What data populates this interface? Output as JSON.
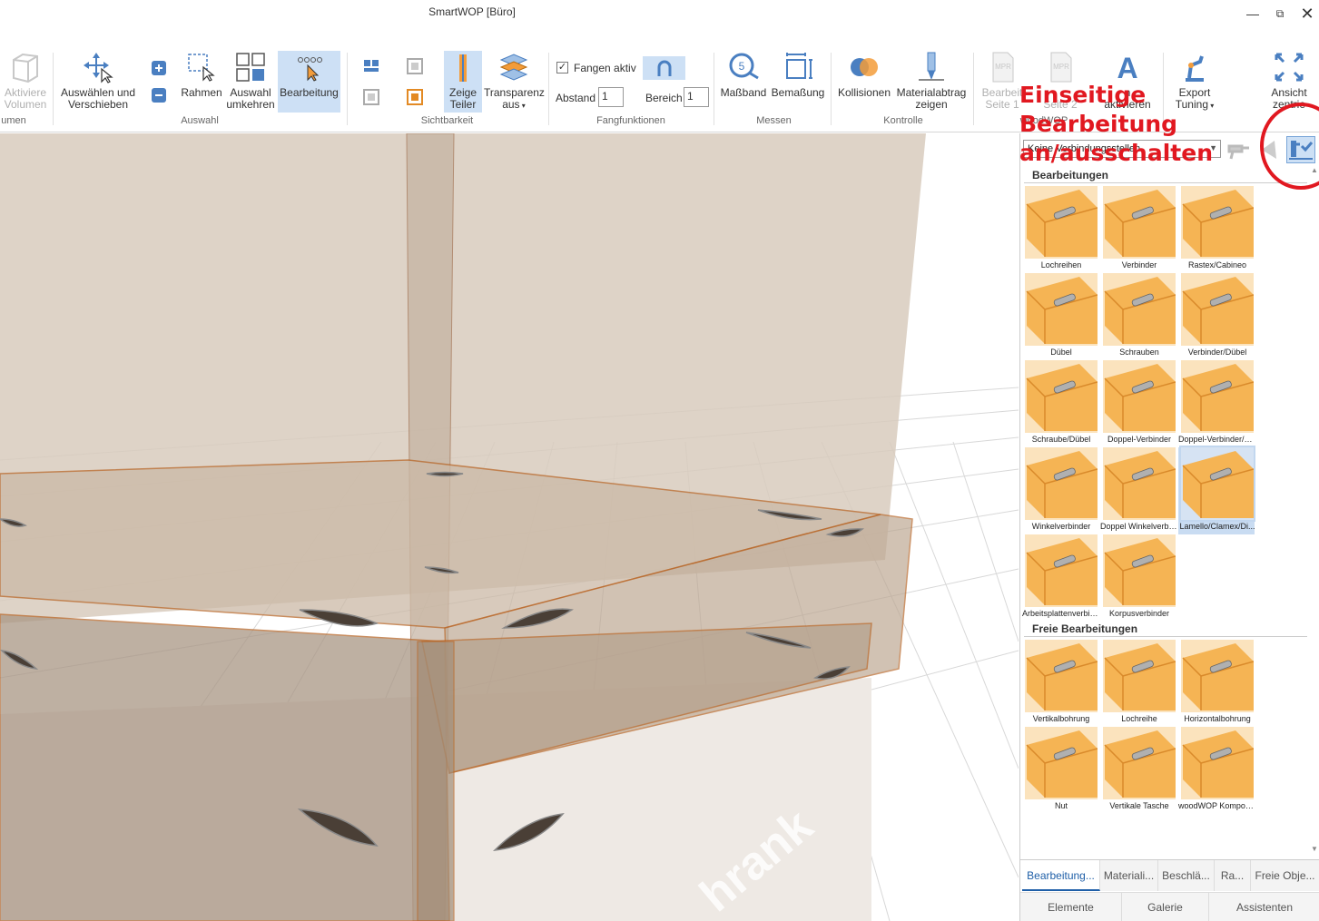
{
  "window": {
    "title": "SmartWOP [Büro]",
    "minimize_icon": "minimize-icon",
    "restore_icon": "restore-icon",
    "close_icon": "close-icon"
  },
  "ribbon": {
    "volumen": {
      "line1": "Aktiviere",
      "line2": "Volumen",
      "group_label": "umen"
    },
    "auswahl": {
      "select_move": {
        "line1": "Auswählen und",
        "line2": "Verschieben"
      },
      "rahmen": "Rahmen",
      "auswahl_umkehren": {
        "line1": "Auswahl",
        "line2": "umkehren"
      },
      "bearbeitung": "Bearbeitung",
      "group_label": "Auswahl"
    },
    "sichtbarkeit": {
      "zeige_teiler": {
        "line1": "Zeige",
        "line2": "Teiler"
      },
      "transparenz": {
        "line1": "Transparenz",
        "line2": "aus"
      },
      "group_label": "Sichtbarkeit"
    },
    "fangfunktionen": {
      "fangen_aktiv": "Fangen aktiv",
      "fangen_checked": true,
      "abstand_label": "Abstand",
      "abstand_value": "1",
      "bereich_label": "Bereich",
      "bereich_value": "1",
      "group_label": "Fangfunktionen"
    },
    "messen": {
      "massband": "Maßband",
      "bemassung": "Bemaßung",
      "group_label": "Messen"
    },
    "kontrolle": {
      "kollisionen": "Kollisionen",
      "materialabtrag": {
        "line1": "Materialabtrag",
        "line2": "zeigen"
      },
      "group_label": "Kontrolle"
    },
    "woodwop": {
      "seite1": {
        "line1": "Bearbeit",
        "line2": "Seite 1"
      },
      "seite2": {
        "line1": "",
        "line2": "Seite 2"
      },
      "aktivieren": {
        "line1": "n",
        "line2": "aktivieren"
      },
      "group_label": "woodWOP"
    },
    "export": {
      "line1": "Export",
      "line2": "Tuning"
    },
    "ansicht": {
      "line1": "Ansicht",
      "line2": "zentrie"
    }
  },
  "panel": {
    "connection_select": "Keine Verbindungsstellen",
    "bearbeitungen_title": "Bearbeitungen",
    "bearbeitungen": [
      "Lochreihen",
      "Verbinder",
      "Rastex/Cabineo",
      "Dübel",
      "Schrauben",
      "Verbinder/Dübel",
      "Schraube/Dübel",
      "Doppel-Verbinder",
      "Doppel-Verbinder/D...",
      "Winkelverbinder",
      "Doppel Winkelverbin...",
      "Lamello/Clamex/Di...",
      "Arbeitsplattenverbin...",
      "Korpusverbinder"
    ],
    "freie_title": "Freie Bearbeitungen",
    "freie": [
      "Vertikalbohrung",
      "Lochreihe",
      "Horizontalbohrung",
      "Nut",
      "Vertikale Tasche",
      "woodWOP Kompon..."
    ],
    "tabs": [
      "Bearbeitung...",
      "Materiali...",
      "Beschlä...",
      "Ra...",
      "Freie Obje..."
    ],
    "bottom_tabs": [
      "Elemente",
      "Galerie",
      "Assistenten"
    ]
  },
  "viewport": {
    "floor_text": "hrank"
  },
  "annotation": {
    "line1": "Einseitige",
    "line2": "Bearbeitung",
    "line3": "an/ausschalten",
    "color": "#e11820"
  },
  "colors": {
    "accent": "#1f5fa8",
    "wood": "#f5b454",
    "active": "#cde0f5"
  }
}
